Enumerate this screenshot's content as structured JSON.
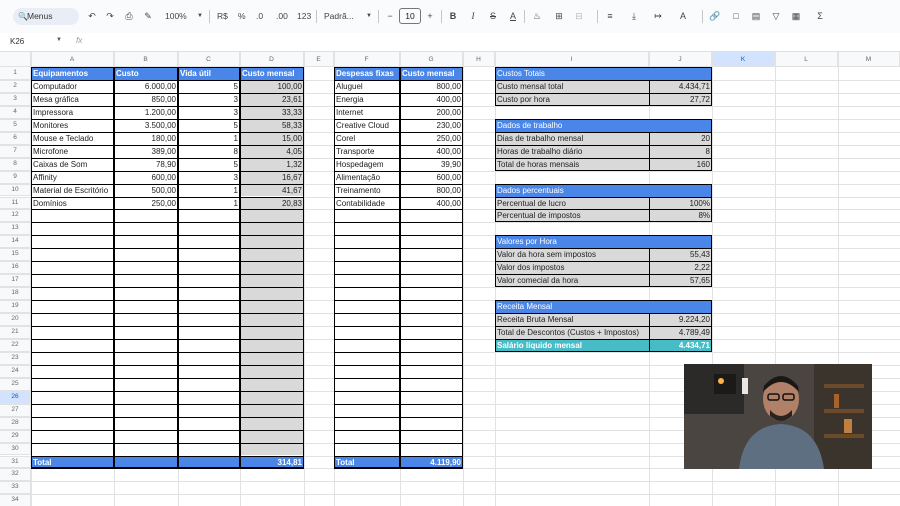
{
  "toolbar": {
    "menus_label": "Menus",
    "zoom": "100%",
    "currency": "R$",
    "percent": "%",
    "dec_dec": ".0",
    "inc_dec": ".00",
    "format_num": "123",
    "font": "Padrã...",
    "font_size": "10"
  },
  "formula_bar": {
    "cell_ref": "K26",
    "fx": "fx"
  },
  "columns": [
    "A",
    "B",
    "C",
    "D",
    "E",
    "F",
    "G",
    "H",
    "I",
    "J",
    "K",
    "L",
    "M"
  ],
  "selected_col": "K",
  "selected_row": "26",
  "rows": [
    "1",
    "2",
    "3",
    "4",
    "5",
    "6",
    "7",
    "8",
    "9",
    "10",
    "11",
    "12",
    "13",
    "14",
    "15",
    "16",
    "17",
    "18",
    "19",
    "20",
    "21",
    "22",
    "23",
    "24",
    "25",
    "26",
    "27",
    "28",
    "29",
    "30",
    "31",
    "32",
    "33",
    "34"
  ],
  "equipamentos": {
    "headers": [
      "Equipamentos",
      "Custo",
      "Vida útil",
      "Custo mensal"
    ],
    "items": [
      [
        "Computador",
        "6.000,00",
        "5",
        "100,00"
      ],
      [
        "Mesa gráfica",
        "850,00",
        "3",
        "23,61"
      ],
      [
        "Impressora",
        "1.200,00",
        "3",
        "33,33"
      ],
      [
        "Monitores",
        "3.500,00",
        "5",
        "58,33"
      ],
      [
        "Mouse e Teclado",
        "180,00",
        "1",
        "15,00"
      ],
      [
        "Microfone",
        "389,00",
        "8",
        "4,05"
      ],
      [
        "Caixas de Som",
        "78,90",
        "5",
        "1,32"
      ],
      [
        "Affinity",
        "600,00",
        "3",
        "16,67"
      ],
      [
        "Material de Escritório",
        "500,00",
        "1",
        "41,67"
      ],
      [
        "Domínios",
        "250,00",
        "1",
        "20,83"
      ]
    ],
    "total_label": "Total",
    "total_value": "314,81"
  },
  "despesas": {
    "headers": [
      "Despesas fixas",
      "Custo mensal"
    ],
    "items": [
      [
        "Aluguel",
        "800,00"
      ],
      [
        "Energia",
        "400,00"
      ],
      [
        "Internet",
        "200,00"
      ],
      [
        "Creative Cloud",
        "230,00"
      ],
      [
        "Corel",
        "250,00"
      ],
      [
        "Transporte",
        "400,00"
      ],
      [
        "Hospedagem",
        "39,90"
      ],
      [
        "Alimentação",
        "600,00"
      ],
      [
        "Treinamento",
        "800,00"
      ],
      [
        "Contabilidade",
        "400,00"
      ]
    ],
    "total_label": "Total",
    "total_value": "4.119,90"
  },
  "custos_totais": {
    "title": "Custos Totais",
    "items": [
      [
        "Custo mensal total",
        "4.434,71"
      ],
      [
        "Custo por hora",
        "27,72"
      ]
    ]
  },
  "dados_trabalho": {
    "title": "Dados de trabalho",
    "items": [
      [
        "Dias de trabalho mensal",
        "20"
      ],
      [
        "Horas de trabalho diário",
        "8"
      ],
      [
        "Total de horas mensais",
        "160"
      ]
    ]
  },
  "dados_percentuais": {
    "title": "Dados percentuais",
    "items": [
      [
        "Percentual de lucro",
        "100%"
      ],
      [
        "Percentual de impostos",
        "8%"
      ]
    ]
  },
  "valores_hora": {
    "title": "Valores por Hora",
    "items": [
      [
        "Valor da hora sem impostos",
        "55,43"
      ],
      [
        "Valor dos impostos",
        "2,22"
      ],
      [
        "Valor comecial da hora",
        "57,65"
      ]
    ]
  },
  "receita_mensal": {
    "title": "Receita Mensal",
    "items": [
      [
        "Receita Bruta Mensal",
        "9.224,20"
      ],
      [
        "Total de Descontos (Custos + Impostos)",
        "4.789,49"
      ]
    ],
    "highlight": [
      "Salário líquido mensal",
      "4.434,71"
    ]
  },
  "colors": {
    "header_blue": "#4a86e8",
    "grey_fill": "#d9d9d9",
    "teal_highlight": "#46bdc6",
    "selection_blue": "#d3e3fd"
  }
}
